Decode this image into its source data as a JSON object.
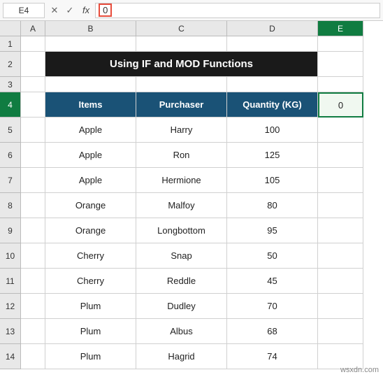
{
  "formula_bar": {
    "cell_ref": "E4",
    "formula_value": "0",
    "fx_label": "fx"
  },
  "columns": {
    "labels": [
      "",
      "A",
      "B",
      "C",
      "D",
      "E"
    ],
    "widths": [
      30,
      35,
      130,
      130,
      130,
      65
    ]
  },
  "rows": [
    {
      "row_num": "1",
      "cells": [
        "",
        "",
        "",
        "",
        ""
      ]
    },
    {
      "row_num": "2",
      "cells": [
        "",
        "Using  IF and MOD Functions",
        "",
        "",
        ""
      ]
    },
    {
      "row_num": "3",
      "cells": [
        "",
        "",
        "",
        "",
        ""
      ]
    },
    {
      "row_num": "4",
      "cells": [
        "",
        "Items",
        "Purchaser",
        "Quantity (KG)",
        "0"
      ],
      "is_header": true
    },
    {
      "row_num": "5",
      "cells": [
        "",
        "Apple",
        "Harry",
        "100",
        ""
      ]
    },
    {
      "row_num": "6",
      "cells": [
        "",
        "Apple",
        "Ron",
        "125",
        ""
      ]
    },
    {
      "row_num": "7",
      "cells": [
        "",
        "Apple",
        "Hermione",
        "105",
        ""
      ]
    },
    {
      "row_num": "8",
      "cells": [
        "",
        "Orange",
        "Malfoy",
        "80",
        ""
      ]
    },
    {
      "row_num": "9",
      "cells": [
        "",
        "Orange",
        "Longbottom",
        "95",
        ""
      ]
    },
    {
      "row_num": "10",
      "cells": [
        "",
        "Cherry",
        "Snap",
        "50",
        ""
      ]
    },
    {
      "row_num": "11",
      "cells": [
        "",
        "Cherry",
        "Reddle",
        "45",
        ""
      ]
    },
    {
      "row_num": "12",
      "cells": [
        "",
        "Plum",
        "Dudley",
        "70",
        ""
      ]
    },
    {
      "row_num": "13",
      "cells": [
        "",
        "Plum",
        "Albus",
        "68",
        ""
      ]
    },
    {
      "row_num": "14",
      "cells": [
        "",
        "Plum",
        "Hagrid",
        "74",
        ""
      ]
    }
  ],
  "watermark": "wsxdn.com"
}
